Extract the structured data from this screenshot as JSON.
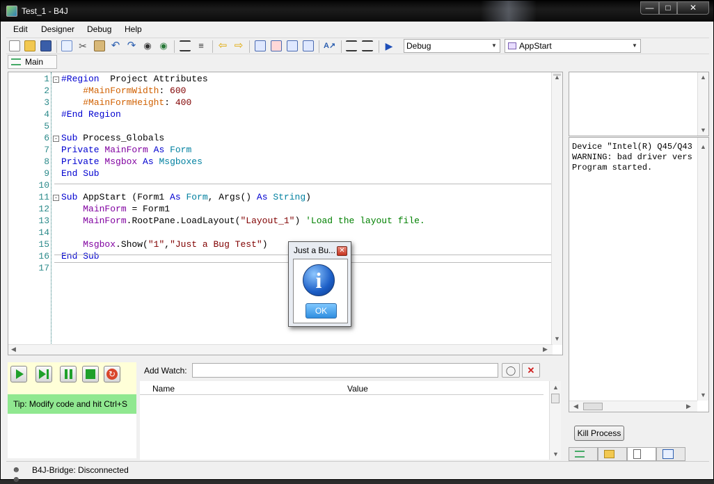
{
  "window": {
    "title": "Test_1 - B4J"
  },
  "menu": [
    "Edit",
    "Designer",
    "Debug",
    "Help"
  ],
  "toolbar": {
    "build_config": "Debug",
    "entry_point": "AppStart"
  },
  "module_tab": "Main",
  "code_lines": [
    {
      "n": "1",
      "fold": "⊟",
      "parts": [
        [
          "k",
          "#Region"
        ],
        [
          "",
          "  Project Attributes"
        ]
      ]
    },
    {
      "n": "2",
      "fold": "",
      "parts": [
        [
          "",
          "    "
        ],
        [
          "d",
          "#MainFormWidth"
        ],
        [
          "",
          ": "
        ],
        [
          "s",
          "600"
        ]
      ]
    },
    {
      "n": "3",
      "fold": "",
      "parts": [
        [
          "",
          "    "
        ],
        [
          "d",
          "#MainFormHeight"
        ],
        [
          "",
          ": "
        ],
        [
          "s",
          "400"
        ]
      ]
    },
    {
      "n": "4",
      "fold": "",
      "parts": [
        [
          "k",
          "#End Region"
        ]
      ]
    },
    {
      "n": "5",
      "fold": "",
      "parts": []
    },
    {
      "n": "6",
      "fold": "⊟",
      "parts": [
        [
          "k",
          "Sub"
        ],
        [
          "",
          " Process_Globals"
        ]
      ]
    },
    {
      "n": "7",
      "fold": "",
      "parts": [
        [
          "k",
          "Private"
        ],
        [
          "",
          " "
        ],
        [
          "v",
          "MainForm"
        ],
        [
          "",
          " "
        ],
        [
          "k",
          "As"
        ],
        [
          "",
          " "
        ],
        [
          "t",
          "Form"
        ]
      ]
    },
    {
      "n": "8",
      "fold": "",
      "parts": [
        [
          "k",
          "Private"
        ],
        [
          "",
          " "
        ],
        [
          "v",
          "Msgbox"
        ],
        [
          "",
          " "
        ],
        [
          "k",
          "As"
        ],
        [
          "",
          " "
        ],
        [
          "t",
          "Msgboxes"
        ]
      ]
    },
    {
      "n": "9",
      "fold": "",
      "parts": [
        [
          "k",
          "End Sub"
        ]
      ]
    },
    {
      "n": "10",
      "fold": "",
      "parts": []
    },
    {
      "n": "11",
      "fold": "⊟",
      "parts": [
        [
          "k",
          "Sub"
        ],
        [
          "",
          " AppStart (Form1 "
        ],
        [
          "k",
          "As"
        ],
        [
          "",
          " "
        ],
        [
          "t",
          "Form"
        ],
        [
          "",
          ", Args() "
        ],
        [
          "k",
          "As"
        ],
        [
          "",
          " "
        ],
        [
          "t",
          "String"
        ],
        [
          "",
          ")"
        ]
      ]
    },
    {
      "n": "12",
      "fold": "",
      "parts": [
        [
          "",
          "    "
        ],
        [
          "v",
          "MainForm"
        ],
        [
          "",
          " = Form1"
        ]
      ]
    },
    {
      "n": "13",
      "fold": "",
      "parts": [
        [
          "",
          "    "
        ],
        [
          "v",
          "MainForm"
        ],
        [
          "",
          ".RootPane.LoadLayout("
        ],
        [
          "s",
          "\"Layout_1\""
        ],
        [
          "",
          ") "
        ],
        [
          "c",
          "'Load the layout file."
        ]
      ]
    },
    {
      "n": "14",
      "fold": "",
      "parts": []
    },
    {
      "n": "15",
      "fold": "",
      "parts": [
        [
          "",
          "    "
        ],
        [
          "v",
          "Msgbox"
        ],
        [
          "",
          ".Show("
        ],
        [
          "s",
          "\"1\""
        ],
        [
          "",
          ","
        ],
        [
          "s",
          "\"Just a Bug Test\""
        ],
        [
          "",
          ")"
        ]
      ]
    },
    {
      "n": "16",
      "fold": "",
      "parts": [
        [
          "k",
          "End Sub"
        ]
      ]
    },
    {
      "n": "17",
      "fold": "",
      "parts": []
    }
  ],
  "log_lines": [
    "Device \"Intel(R) Q45/Q43",
    "WARNING: bad driver vers",
    "Program started."
  ],
  "kill_process_label": "Kill Process",
  "debug": {
    "tip": "Tip: Modify code and hit Ctrl+S"
  },
  "watch": {
    "label": "Add Watch:",
    "input_value": "",
    "col_name": "Name",
    "col_value": "Value"
  },
  "status": {
    "bridge": "B4J-Bridge: Disconnected"
  },
  "dialog": {
    "title": "Just a Bu...",
    "ok_label": "OK"
  }
}
